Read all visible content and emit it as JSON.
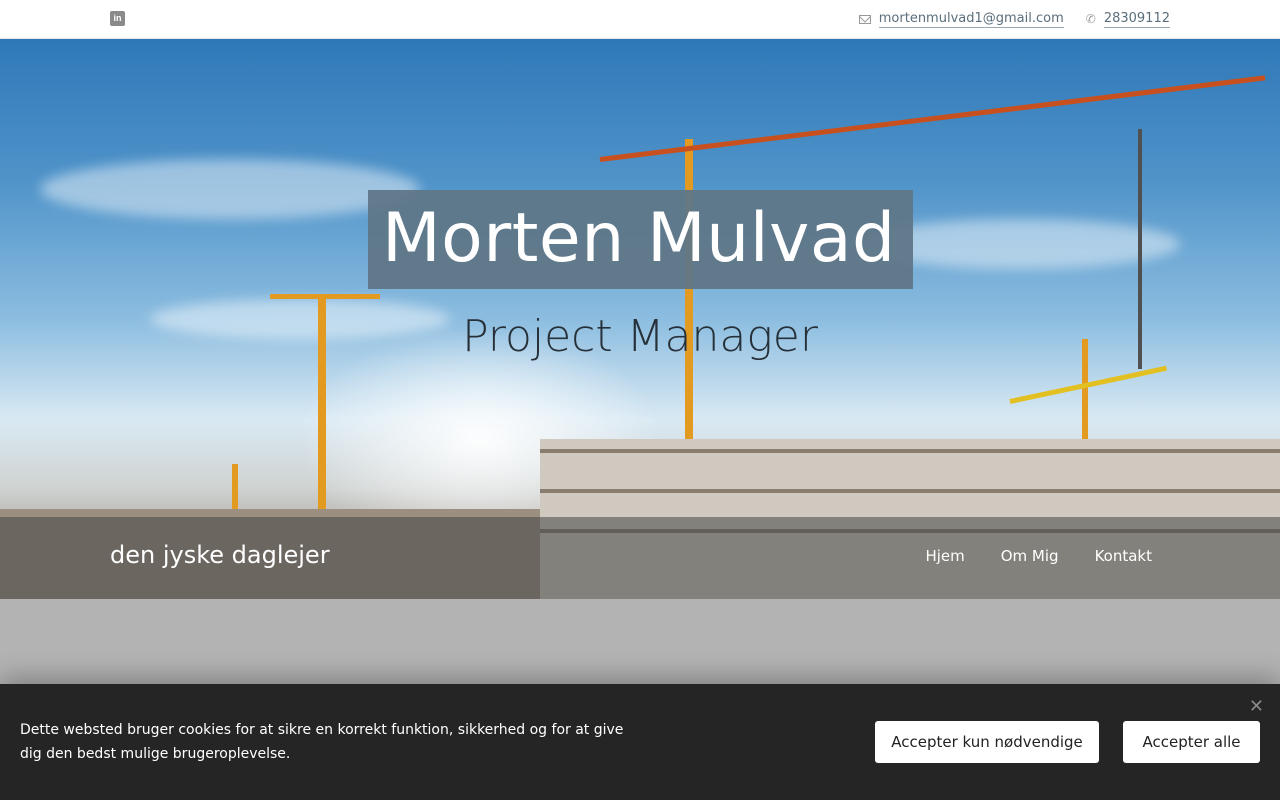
{
  "topbar": {
    "linkedin_icon": "linkedin-icon",
    "email": "mortenmulvad1@gmail.com",
    "phone": "28309112",
    "email_icon": "mail-icon",
    "phone_icon": "phone-icon"
  },
  "hero": {
    "title": "Morten Mulvad",
    "subtitle": "Project Manager",
    "title_box_color": "#5f7788"
  },
  "navbar": {
    "brand": "den jyske daglejer",
    "items": [
      {
        "label": "Hjem"
      },
      {
        "label": "Om Mig"
      },
      {
        "label": "Kontakt"
      }
    ]
  },
  "cookie": {
    "text": "Dette websted bruger cookies for at sikre en korrekt funktion, sikkerhed og for at give dig den bedst mulige brugeroplevelse.",
    "necessary_label": "Accepter kun nødvendige",
    "accept_all_label": "Accepter alle",
    "close_icon": "close-icon",
    "background": "#252525"
  }
}
